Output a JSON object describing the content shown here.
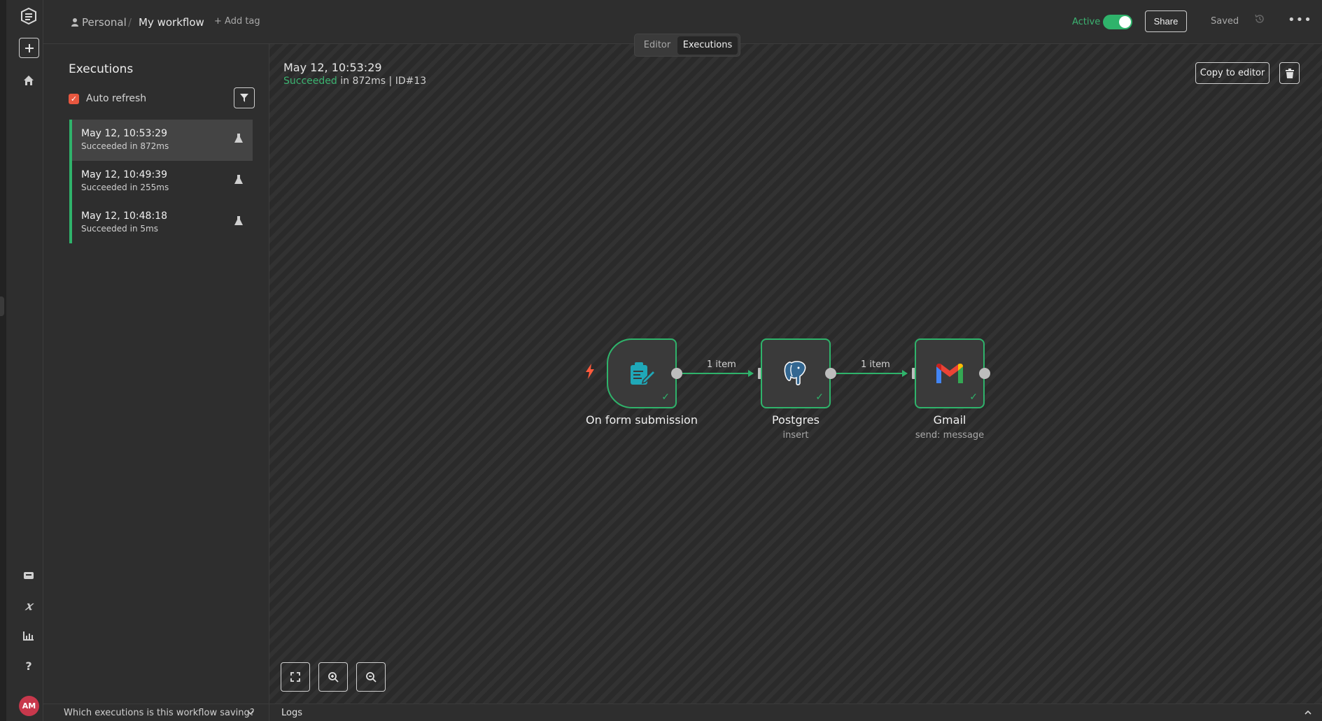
{
  "header": {
    "project": "Personal",
    "workflow_name": "My workflow",
    "add_tag": "+ Add tag",
    "active_label": "Active",
    "active": true,
    "share": "Share",
    "saved": "Saved",
    "view_tabs": [
      "Editor",
      "Executions"
    ],
    "selected_view": "Executions"
  },
  "sidebar": {
    "title": "Executions",
    "auto_refresh_label": "Auto refresh",
    "auto_refresh_checked": true,
    "executions": [
      {
        "time": "May 12, 10:53:29",
        "status": "Succeeded in 872ms",
        "selected": true
      },
      {
        "time": "May 12, 10:49:39",
        "status": "Succeeded in 255ms",
        "selected": false
      },
      {
        "time": "May 12, 10:48:18",
        "status": "Succeeded in 5ms",
        "selected": false
      }
    ],
    "footer": "Which executions is this workflow saving?"
  },
  "execution": {
    "time": "May 12, 10:53:29",
    "status_word": "Succeeded",
    "details": "in 872ms | ID#13",
    "copy_to_editor": "Copy to editor"
  },
  "workflow": {
    "nodes": [
      {
        "name": "On form submission",
        "subtitle": "",
        "icon": "form-icon"
      },
      {
        "name": "Postgres",
        "subtitle": "insert",
        "icon": "postgres-elephant-icon"
      },
      {
        "name": "Gmail",
        "subtitle": "send: message",
        "icon": "gmail-icon"
      }
    ],
    "connections": [
      {
        "label": "1 item"
      },
      {
        "label": "1 item"
      }
    ]
  },
  "logs": {
    "label": "Logs"
  },
  "user": {
    "initials": "AM"
  },
  "colors": {
    "success": "#2fb36b",
    "accent": "#e8573f",
    "avatar": "#c8384c",
    "trigger_bolt": "#ff5a3c"
  }
}
